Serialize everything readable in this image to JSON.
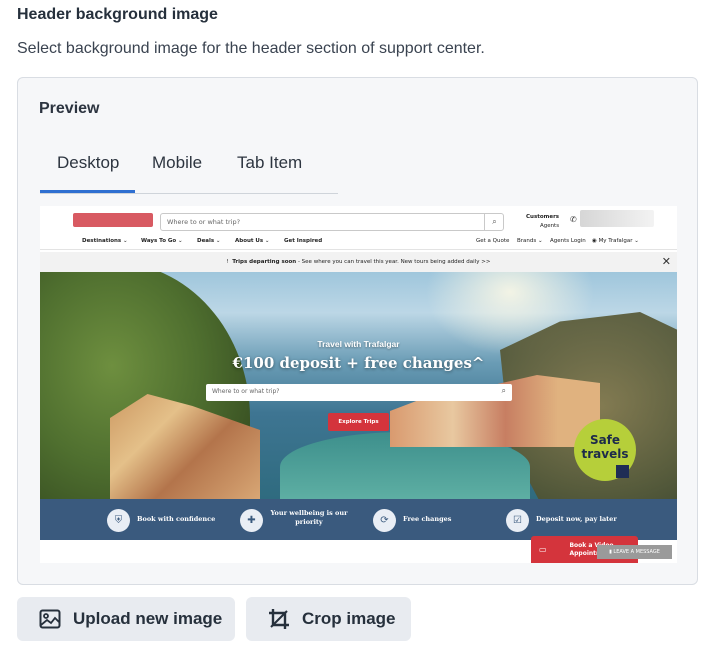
{
  "section": {
    "title": "Header background image",
    "description": "Select background image for the header section of support center."
  },
  "preview": {
    "title": "Preview",
    "tabs": [
      {
        "label": "Desktop",
        "active": true
      },
      {
        "label": "Mobile",
        "active": false
      },
      {
        "label": "Tab Item",
        "active": false
      }
    ],
    "accent_color": "#2f6fd1"
  },
  "site": {
    "search_placeholder": "Where to or what trip?",
    "customers_label": "Customers",
    "agents_label": "Agents",
    "nav": [
      "Destinations",
      "Ways To Go",
      "Deals",
      "About Us",
      "Get Inspired"
    ],
    "nav_right": [
      "Get a Quote",
      "Brands",
      "Agents Login",
      "My Trafalgar"
    ],
    "banner_bold": "Trips departing soon",
    "banner_text": " - See where you can travel this year. New tours being added daily >>",
    "hero_kicker": "Travel with Trafalgar",
    "hero_headline": "€100 deposit + free changes^",
    "hero_search_placeholder": "Where to or what trip?",
    "hero_button": "Explore Trips",
    "badge_line1": "Safe",
    "badge_line2": "travels",
    "trust_items": [
      "Book with confidence",
      "Your wellbeing is our priority",
      "Free changes",
      "Deposit now, pay later"
    ],
    "video_button": "Book a Video Appointment",
    "leave_message": "LEAVE A MESSAGE"
  },
  "actions": {
    "upload_label": "Upload new image",
    "crop_label": "Crop image"
  }
}
